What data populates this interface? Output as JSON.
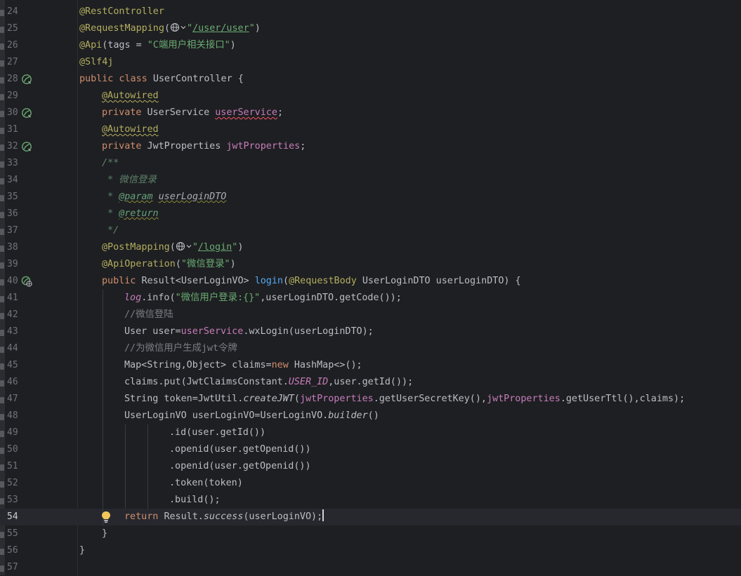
{
  "editor": {
    "first_line": 24,
    "current_line": 54,
    "lines": [
      {
        "n": "24",
        "indent": 0,
        "gutter": "",
        "t": [
          [
            "@RestController",
            "ann"
          ]
        ]
      },
      {
        "n": "25",
        "indent": 0,
        "gutter": "",
        "t": [
          [
            "@RequestMapping",
            "ann"
          ],
          [
            "(",
            ""
          ],
          [
            "",
            "globe"
          ],
          [
            "\"",
            "str"
          ],
          [
            "/user/user",
            "str ulink"
          ],
          [
            "\"",
            "str"
          ],
          [
            ")",
            ""
          ]
        ]
      },
      {
        "n": "26",
        "indent": 0,
        "gutter": "",
        "t": [
          [
            "@Api",
            "ann"
          ],
          [
            "(tags = ",
            ""
          ],
          [
            "\"C端用户相关接口\"",
            "str"
          ],
          [
            ")",
            ""
          ]
        ]
      },
      {
        "n": "27",
        "indent": 0,
        "gutter": "",
        "t": [
          [
            "@Slf4j",
            "ann"
          ]
        ]
      },
      {
        "n": "28",
        "indent": 0,
        "gutter": "bean",
        "t": [
          [
            "public class ",
            "kw"
          ],
          [
            "UserController {",
            ""
          ]
        ]
      },
      {
        "n": "29",
        "indent": 1,
        "gutter": "",
        "t": [
          [
            "@Autowired",
            "ann warn"
          ]
        ]
      },
      {
        "n": "30",
        "indent": 1,
        "gutter": "bean",
        "t": [
          [
            "private ",
            "kw"
          ],
          [
            "UserService ",
            ""
          ],
          [
            "userService",
            "fld err"
          ],
          [
            ";",
            ""
          ]
        ]
      },
      {
        "n": "31",
        "indent": 1,
        "gutter": "",
        "t": [
          [
            "@Autowired",
            "ann warn"
          ]
        ]
      },
      {
        "n": "32",
        "indent": 1,
        "gutter": "bean",
        "t": [
          [
            "private ",
            "kw"
          ],
          [
            "JwtProperties ",
            ""
          ],
          [
            "jwtProperties",
            "fld"
          ],
          [
            ";",
            ""
          ]
        ]
      },
      {
        "n": "33",
        "indent": 1,
        "gutter": "",
        "t": [
          [
            "/**",
            "doc"
          ]
        ]
      },
      {
        "n": "34",
        "indent": 1,
        "gutter": "",
        "t": [
          [
            " * 微信登录",
            "doc"
          ]
        ]
      },
      {
        "n": "35",
        "indent": 1,
        "gutter": "",
        "t": [
          [
            " * ",
            "doc"
          ],
          [
            "@param",
            "doctag"
          ],
          [
            " ",
            "doc"
          ],
          [
            "userLoginDTO",
            "docparam"
          ]
        ]
      },
      {
        "n": "36",
        "indent": 1,
        "gutter": "",
        "t": [
          [
            " * ",
            "doc"
          ],
          [
            "@return",
            "doctag"
          ]
        ]
      },
      {
        "n": "37",
        "indent": 1,
        "gutter": "",
        "t": [
          [
            " */",
            "doc"
          ]
        ]
      },
      {
        "n": "38",
        "indent": 1,
        "gutter": "",
        "t": [
          [
            "@PostMapping",
            "ann"
          ],
          [
            "(",
            ""
          ],
          [
            "",
            "globe"
          ],
          [
            "\"",
            "str"
          ],
          [
            "/login",
            "str ulink"
          ],
          [
            "\"",
            "str"
          ],
          [
            ")",
            ""
          ]
        ]
      },
      {
        "n": "39",
        "indent": 1,
        "gutter": "",
        "t": [
          [
            "@ApiOperation",
            "ann"
          ],
          [
            "(",
            ""
          ],
          [
            "\"微信登录\"",
            "str"
          ],
          [
            ")",
            ""
          ]
        ]
      },
      {
        "n": "40",
        "indent": 1,
        "gutter": "web",
        "t": [
          [
            "public ",
            "kw"
          ],
          [
            "Result<UserLoginVO> ",
            ""
          ],
          [
            "login",
            "fn"
          ],
          [
            "(",
            ""
          ],
          [
            "@RequestBody",
            "ann"
          ],
          [
            " UserLoginDTO userLoginDTO) {",
            ""
          ]
        ]
      },
      {
        "n": "41",
        "indent": 2,
        "gutter": "",
        "t": [
          [
            "log",
            "static"
          ],
          [
            ".info(",
            ""
          ],
          [
            "\"微信用户登录:{}\"",
            "str"
          ],
          [
            ",userLoginDTO.getCode());",
            ""
          ]
        ]
      },
      {
        "n": "42",
        "indent": 2,
        "gutter": "",
        "t": [
          [
            "//微信登陆",
            "cm"
          ]
        ]
      },
      {
        "n": "43",
        "indent": 2,
        "gutter": "",
        "t": [
          [
            "User user=",
            ""
          ],
          [
            "userService",
            "fld"
          ],
          [
            ".wxLogin(userLoginDTO);",
            ""
          ]
        ]
      },
      {
        "n": "44",
        "indent": 2,
        "gutter": "",
        "t": [
          [
            "//为微信用户生成jwt令牌",
            "cm"
          ]
        ]
      },
      {
        "n": "45",
        "indent": 2,
        "gutter": "",
        "t": [
          [
            "Map<String,Object> claims=",
            ""
          ],
          [
            "new ",
            "kw"
          ],
          [
            "HashMap<>();",
            ""
          ]
        ]
      },
      {
        "n": "46",
        "indent": 2,
        "gutter": "",
        "t": [
          [
            "claims.put(JwtClaimsConstant.",
            ""
          ],
          [
            "USER_ID",
            "static"
          ],
          [
            ",user.getId());",
            ""
          ]
        ]
      },
      {
        "n": "47",
        "indent": 2,
        "gutter": "",
        "t": [
          [
            "String token=JwtUtil.",
            ""
          ],
          [
            "createJWT",
            "ital"
          ],
          [
            "(",
            ""
          ],
          [
            "jwtProperties",
            "fld"
          ],
          [
            ".getUserSecretKey(),",
            ""
          ],
          [
            "jwtProperties",
            "fld"
          ],
          [
            ".getUserTtl(),claims);",
            ""
          ]
        ]
      },
      {
        "n": "48",
        "indent": 2,
        "gutter": "",
        "t": [
          [
            "UserLoginVO userLoginVO=UserLoginVO.",
            ""
          ],
          [
            "builder",
            "ital"
          ],
          [
            "()",
            ""
          ]
        ]
      },
      {
        "n": "49",
        "indent": 4,
        "gutter": "",
        "t": [
          [
            ".id(user.getId())",
            ""
          ]
        ]
      },
      {
        "n": "50",
        "indent": 4,
        "gutter": "",
        "t": [
          [
            ".openid(user.getOpenid())",
            ""
          ]
        ]
      },
      {
        "n": "51",
        "indent": 4,
        "gutter": "",
        "t": [
          [
            ".openid(user.getOpenid())",
            ""
          ]
        ]
      },
      {
        "n": "52",
        "indent": 4,
        "gutter": "",
        "t": [
          [
            ".token(token)",
            ""
          ]
        ]
      },
      {
        "n": "53",
        "indent": 4,
        "gutter": "",
        "t": [
          [
            ".build();",
            ""
          ]
        ]
      },
      {
        "n": "54",
        "indent": 2,
        "gutter": "",
        "t": [
          [
            "return ",
            "kw"
          ],
          [
            "Result.",
            ""
          ],
          [
            "success",
            "ital"
          ],
          [
            "(userLoginVO);",
            ""
          ],
          [
            "",
            "caret"
          ]
        ]
      },
      {
        "n": "55",
        "indent": 1,
        "gutter": "",
        "t": [
          [
            "}",
            ""
          ]
        ]
      },
      {
        "n": "56",
        "indent": 0,
        "gutter": "",
        "t": [
          [
            "}",
            ""
          ]
        ]
      },
      {
        "n": "57",
        "indent": 0,
        "gutter": "",
        "t": []
      }
    ]
  },
  "colors": {
    "background": "#1e1f22",
    "current_line": "#26282e",
    "annotation": "#b3ae60",
    "keyword": "#cf8e6d",
    "string": "#6aab73",
    "field": "#c77dbb",
    "method": "#56a8f5",
    "comment": "#7a7e85"
  },
  "icons": {
    "bean_gutter": "spring-bean-icon",
    "web_gutter": "spring-web-endpoint-icon",
    "url_globe": "globe-icon",
    "intention": "lightbulb-icon"
  }
}
